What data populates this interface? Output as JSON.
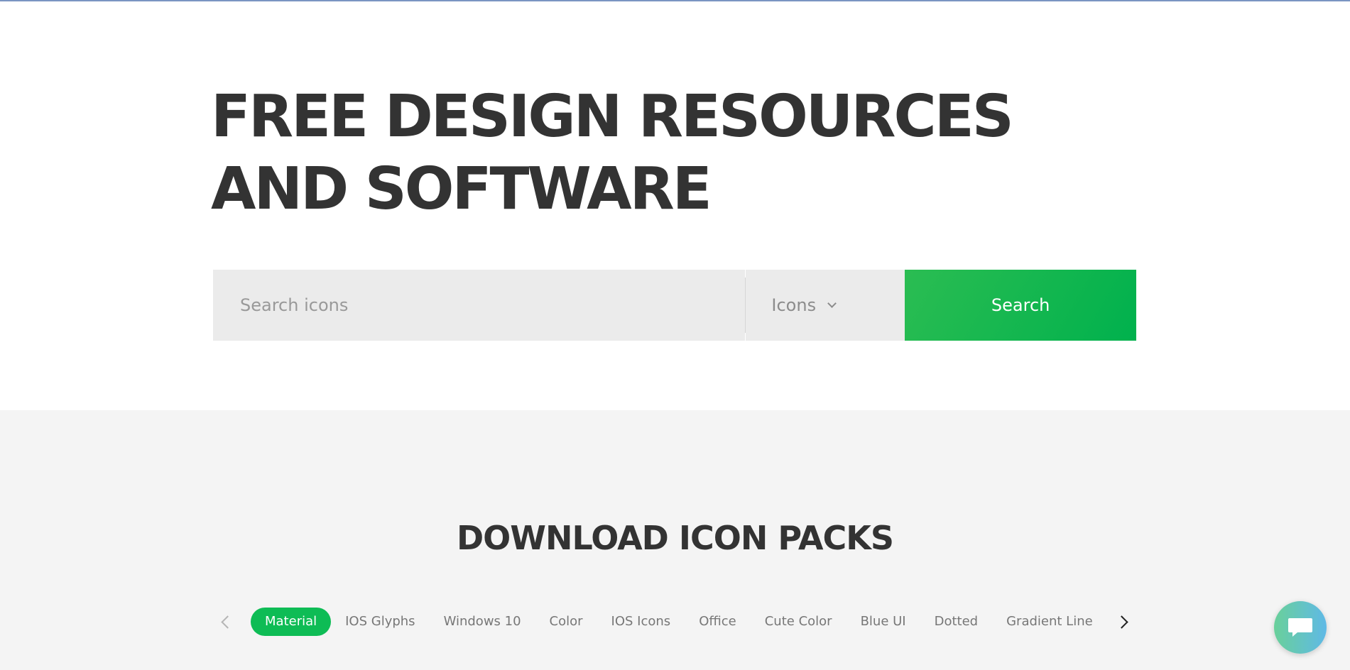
{
  "hero": {
    "title_line1": "FREE DESIGN RESOURCES",
    "title_line2": "AND SOFTWARE"
  },
  "search": {
    "placeholder": "Search icons",
    "category_selected": "Icons",
    "button_label": "Search"
  },
  "packs": {
    "title": "DOWNLOAD ICON PACKS",
    "items": [
      {
        "label": "Material",
        "active": true
      },
      {
        "label": "IOS Glyphs",
        "active": false
      },
      {
        "label": "Windows 10",
        "active": false
      },
      {
        "label": "Color",
        "active": false
      },
      {
        "label": "IOS Icons",
        "active": false
      },
      {
        "label": "Office",
        "active": false
      },
      {
        "label": "Cute Color",
        "active": false
      },
      {
        "label": "Blue UI",
        "active": false
      },
      {
        "label": "Dotted",
        "active": false
      },
      {
        "label": "Gradient Line",
        "active": false
      }
    ]
  },
  "colors": {
    "accent_green": "#0ebc55",
    "text_dark": "#333333",
    "section_gray": "#f4f4f4",
    "input_gray": "#ebebeb"
  },
  "icons": {
    "prev": "chevron-left-icon",
    "next": "chevron-right-icon",
    "dropdown": "chevron-down-icon",
    "chat": "chat-icon"
  }
}
